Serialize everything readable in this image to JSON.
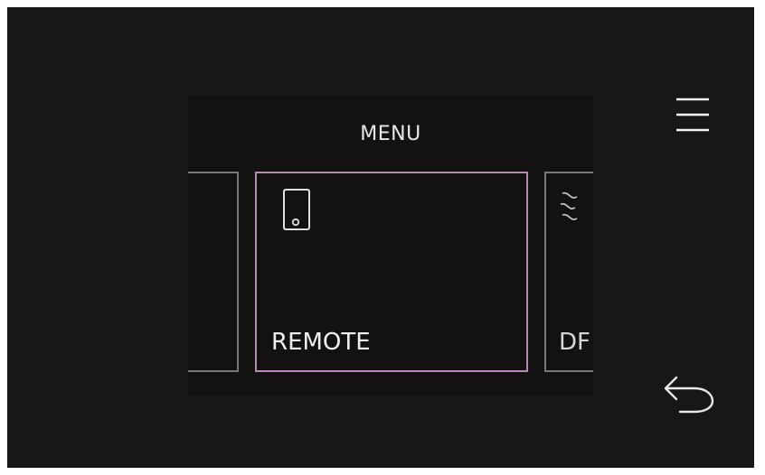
{
  "menu": {
    "title": "MENU",
    "cards": [
      {
        "label": "",
        "icon": "blank-icon"
      },
      {
        "label": "REMOTE",
        "icon": "phone-icon",
        "selected": true,
        "border_color": "#b88ab8"
      },
      {
        "label": "DF",
        "icon": "steam-icon"
      }
    ]
  },
  "controls": {
    "menu_icon": "hamburger-menu-icon",
    "back_icon": "back-arrow-icon"
  },
  "colors": {
    "background": "#181716",
    "panel": "#131211",
    "selected_border": "#b88ab8",
    "card_border": "#7a7777",
    "text": "#f0f0f0"
  }
}
